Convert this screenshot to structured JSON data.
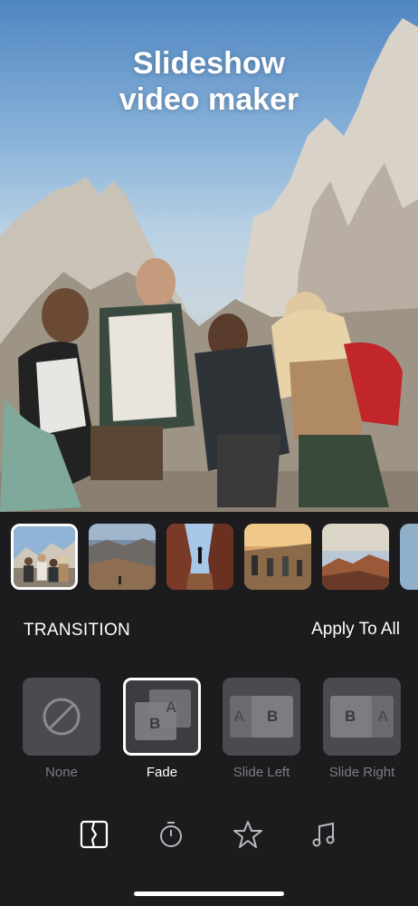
{
  "hero": {
    "title_line1": "Slideshow",
    "title_line2": "video maker"
  },
  "thumbnails": [
    {
      "subject": "group-of-hikers",
      "selected": true
    },
    {
      "subject": "canyon-landscape",
      "selected": false
    },
    {
      "subject": "hiker-in-rock-gap",
      "selected": false
    },
    {
      "subject": "hikers-on-trail",
      "selected": false
    },
    {
      "subject": "mountain-sunset",
      "selected": false
    },
    {
      "subject": "partial-thumbnail",
      "selected": false
    }
  ],
  "transition": {
    "title": "TRANSITION",
    "apply_all_label": "Apply To All",
    "options": [
      {
        "label": "None",
        "icon": "prohibited-icon",
        "selected": false
      },
      {
        "label": "Fade",
        "icon": "fade-icon",
        "selected": true
      },
      {
        "label": "Slide Left",
        "icon": "slide-left-icon",
        "selected": false
      },
      {
        "label": "Slide Right",
        "icon": "slide-right-icon",
        "selected": false
      }
    ],
    "letters": {
      "a": "A",
      "b": "B"
    }
  },
  "toolbar": {
    "items": [
      {
        "icon": "transition-icon",
        "active": true
      },
      {
        "icon": "timer-icon",
        "active": false
      },
      {
        "icon": "star-icon",
        "active": false
      },
      {
        "icon": "music-note-icon",
        "active": false
      }
    ]
  },
  "colors": {
    "background": "#1c1c1e",
    "option_tile": "#4a4a4f",
    "label_inactive": "#7c7c82",
    "accent": "#ffffff"
  }
}
